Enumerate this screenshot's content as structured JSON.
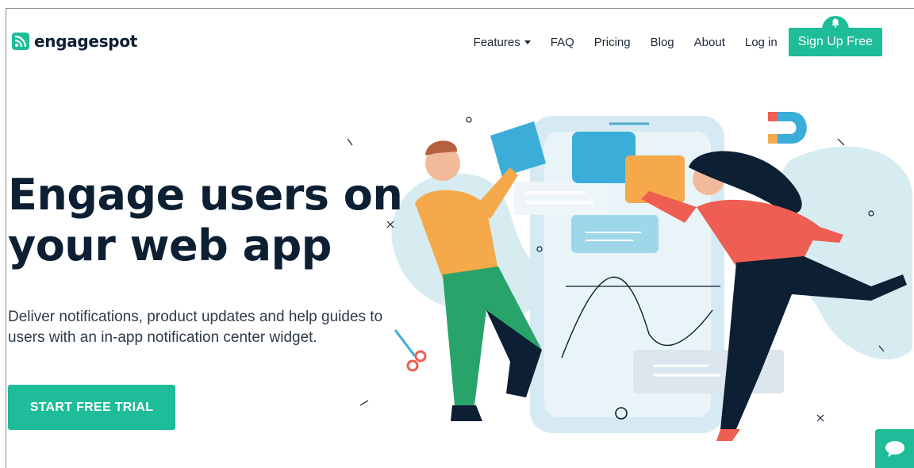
{
  "brand": {
    "name": "engagespot",
    "color": "#1fbc99",
    "icon": "rss-icon"
  },
  "nav": {
    "items": [
      "Features",
      "FAQ",
      "Pricing",
      "Blog",
      "About",
      "Log in"
    ],
    "features_has_dropdown": true,
    "signup_label": "Sign Up Free",
    "signup_icon": "bell-icon"
  },
  "hero": {
    "title_line1": "Engage users on",
    "title_line2": "your web app",
    "subtitle": "Deliver notifications, product updates and help guides to users with an in-app notification center widget.",
    "cta_label": "START FREE TRIAL"
  },
  "chat_widget": {
    "icon": "chat-bubble-icon"
  },
  "colors": {
    "accent": "#1fbc99",
    "heading": "#0c1f33",
    "text": "#2d3b4a"
  }
}
